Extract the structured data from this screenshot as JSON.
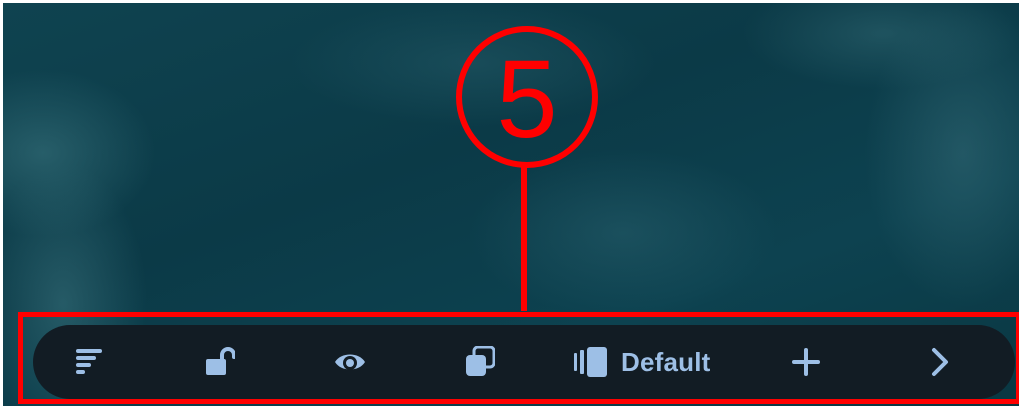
{
  "callout": {
    "number": "5",
    "color": "#ff0000"
  },
  "toolbar": {
    "background": "#121c24",
    "icon_color": "#9dbfe6",
    "items": [
      {
        "name": "sort-icon"
      },
      {
        "name": "unlock-icon"
      },
      {
        "name": "eye-icon"
      },
      {
        "name": "copy-layers-icon"
      },
      {
        "name": "layer-stack-icon",
        "label": "Default"
      },
      {
        "name": "plus-icon"
      },
      {
        "name": "chevron-right-icon"
      }
    ]
  }
}
